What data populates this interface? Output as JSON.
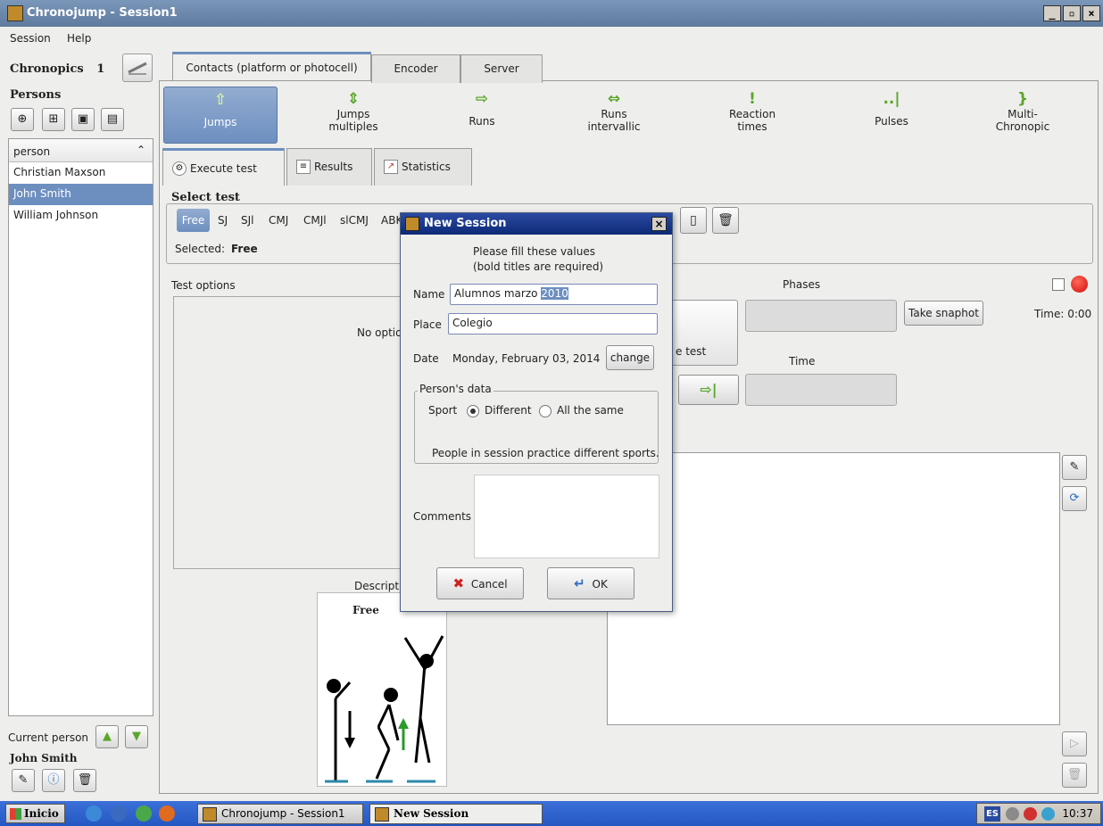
{
  "window": {
    "title": "Chronojump - Session1"
  },
  "menu": {
    "items": [
      "Session",
      "Help"
    ]
  },
  "left": {
    "chronopics_label": "Chronopics",
    "chronopics_count": "1",
    "persons_label": "Persons",
    "list_header": "person",
    "persons": [
      "Christian Maxson",
      "John Smith",
      "William Johnson"
    ],
    "selected_person": "John Smith",
    "current_person_label": "Current person",
    "current_person_name": "John Smith"
  },
  "tabs": [
    "Contacts (platform or photocell)",
    "Encoder",
    "Server"
  ],
  "toolbar": {
    "jumps": "Jumps",
    "jumps_multiples": "Jumps\nmultiples",
    "runs": "Runs",
    "runs_intervallic": "Runs\nintervallic",
    "reaction_times": "Reaction\ntimes",
    "pulses": "Pulses",
    "multichronopic": "Multi-\nChronopic"
  },
  "subtabs": [
    "Execute test",
    "Results",
    "Statistics"
  ],
  "select_test": {
    "label": "Select test",
    "types": [
      "Free",
      "SJ",
      "SJl",
      "CMJ",
      "CMJl",
      "slCMJ",
      "ABK"
    ],
    "selected_label": "Selected:",
    "selected_value": "Free"
  },
  "test_options": {
    "label": "Test options",
    "no_options": "No options"
  },
  "description": {
    "label": "Descripti",
    "title": "Free"
  },
  "execute": {
    "phases_label": "Phases",
    "exec_label": "e test",
    "snapshot": "Take snaphot",
    "time_top": "Time: 0:00",
    "time_label": "Time"
  },
  "dialog": {
    "title": "New Session",
    "intro_line1": "Please fill these values",
    "intro_line2": "(bold titles are required)",
    "name_label": "Name",
    "name_value": "Alumnos marzo",
    "name_value_selected": "2010",
    "place_label": "Place",
    "place_value": "Colegio",
    "date_label": "Date",
    "date_value": "Monday, February 03, 2014",
    "change_label": "change",
    "person_data_label": "Person's data",
    "sport_label": "Sport",
    "opt_different": "Different",
    "opt_same": "All the same",
    "sport_note": "People in session practice different sports.",
    "comments_label": "Comments",
    "cancel": "Cancel",
    "ok": "OK"
  },
  "taskbar": {
    "start": "Inicio",
    "tasks": [
      "Chronojump - Session1",
      "New Session"
    ],
    "lang": "ES",
    "clock": "10:37"
  },
  "colors": {
    "accent": "#6d8fc0",
    "title_active": "#0d2a78",
    "green_icon": "#5aa62a",
    "record": "#d00a0a"
  }
}
